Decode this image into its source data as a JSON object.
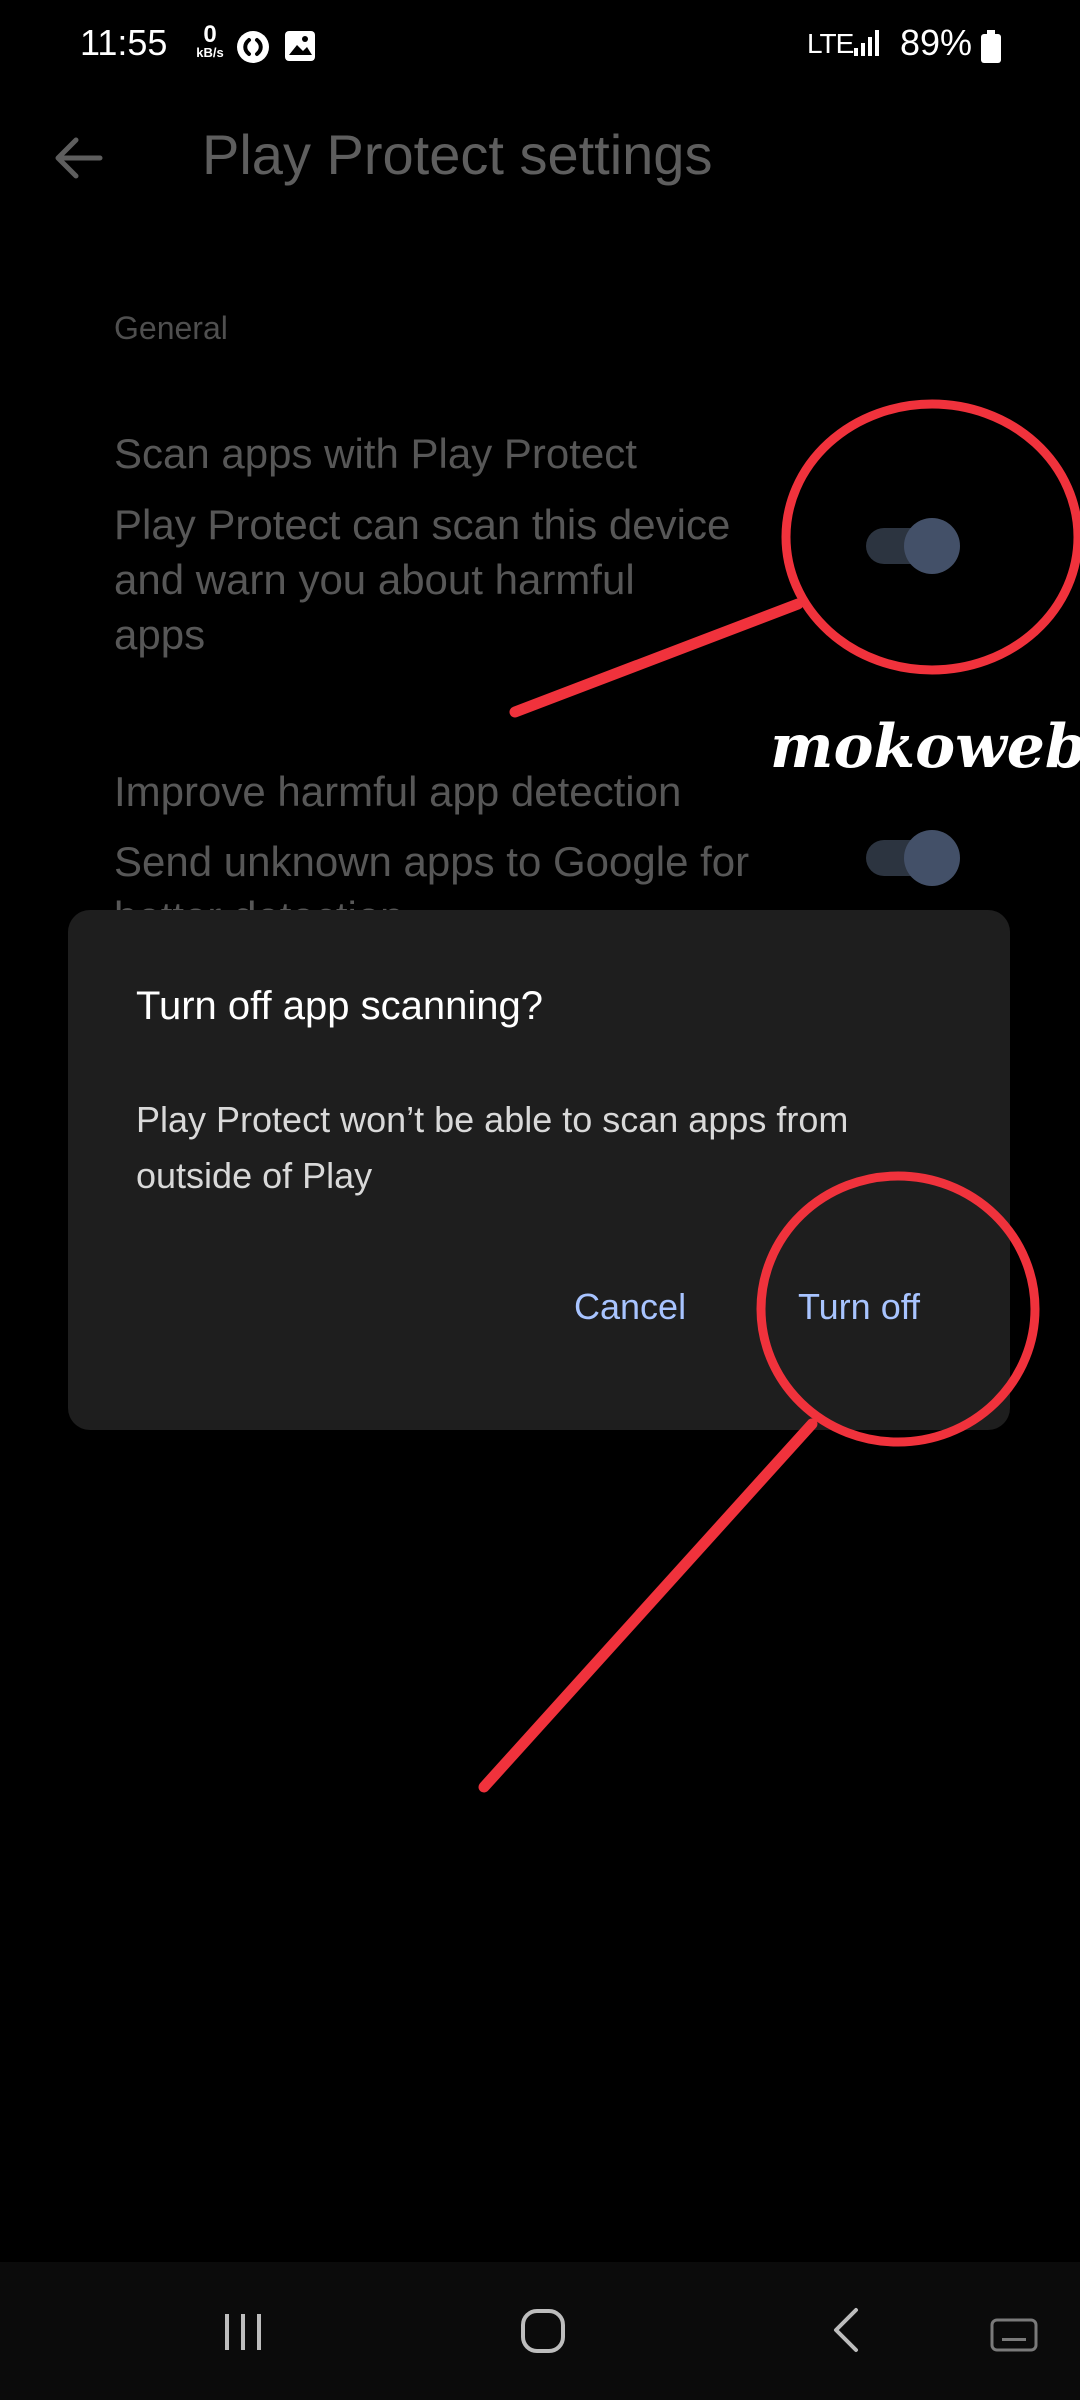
{
  "status_bar": {
    "time": "11:55",
    "net_speed_value": "0",
    "net_speed_unit": "kB/s",
    "network": "LTE",
    "battery": "89%",
    "icons": [
      "shazam-icon",
      "gallery-icon",
      "signal-icon",
      "battery-icon"
    ]
  },
  "app_bar": {
    "title": "Play Protect settings"
  },
  "settings": {
    "section_header": "General",
    "items": [
      {
        "title": "Scan apps with Play Protect",
        "description": "Play Protect can scan this device and warn you about harmful apps",
        "enabled": true
      },
      {
        "title": "Improve harmful app detection",
        "description": "Send unknown apps to Google for better detection",
        "enabled": true
      }
    ]
  },
  "watermark": "mokoweb.",
  "dialog": {
    "title": "Turn off app scanning?",
    "message": "Play Protect won’t be able to scan apps from outside of Play",
    "cancel_label": "Cancel",
    "confirm_label": "Turn off"
  },
  "colors": {
    "background": "#000000",
    "dialog_bg": "#1e1e1e",
    "button_text": "#a8c4ff",
    "annotation": "#f0323c"
  },
  "nav_bar": {
    "icons": [
      "recents-icon",
      "home-icon",
      "back-icon",
      "keyboard-icon"
    ]
  }
}
